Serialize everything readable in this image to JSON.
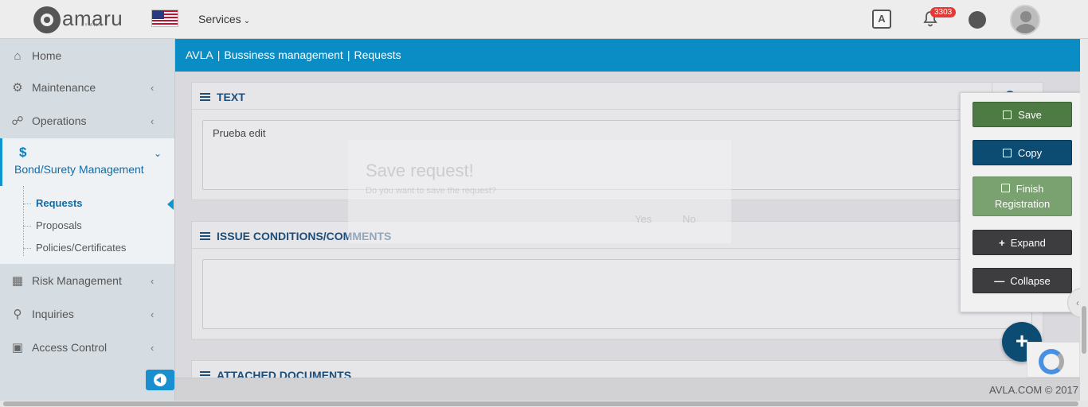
{
  "header": {
    "logo_text": "amaru",
    "logo_sub": "BY AVLA",
    "services_label": "Services",
    "notifications_count": "3303"
  },
  "sidebar": {
    "items": [
      {
        "label": "Home",
        "icon": "home-icon"
      },
      {
        "label": "Maintenance",
        "icon": "gear-icon"
      },
      {
        "label": "Operations",
        "icon": "handshake-icon"
      },
      {
        "label": "Bond/Surety Management",
        "icon": "dollar-icon"
      },
      {
        "label": "Risk Management",
        "icon": "cubes-icon"
      },
      {
        "label": "Inquiries",
        "icon": "search-icon"
      },
      {
        "label": "Access Control",
        "icon": "lock-icon"
      }
    ],
    "subitems": [
      {
        "label": "Requests"
      },
      {
        "label": "Proposals"
      },
      {
        "label": "Policies/Certificates"
      }
    ]
  },
  "breadcrumb": [
    "AVLA",
    "Bussiness management",
    "Requests"
  ],
  "panels": {
    "text": {
      "title": "TEXT",
      "value": "Prueba edit"
    },
    "issue": {
      "title": "ISSUE CONDITIONS/COMMENTS",
      "value": ""
    },
    "attached": {
      "title": "ATTACHED DOCUMENTS"
    }
  },
  "modal": {
    "title": "Save request!",
    "text": "Do you want to save the request?",
    "yes": "Yes",
    "no": "No"
  },
  "actions": {
    "save": "Save",
    "copy": "Copy",
    "finish_line1": "Finish",
    "finish_line2": "Registration",
    "expand": "Expand",
    "collapse": "Collapse"
  },
  "footer": {
    "copyright": "AVLA.COM © 2017"
  },
  "colors": {
    "brand_blue": "#0a8cc4",
    "save_green": "#4e7a43",
    "copy_navy": "#0c4b72",
    "finish_green": "#7aa170",
    "dark_btn": "#3d3d40",
    "badge_red": "#e53935"
  }
}
